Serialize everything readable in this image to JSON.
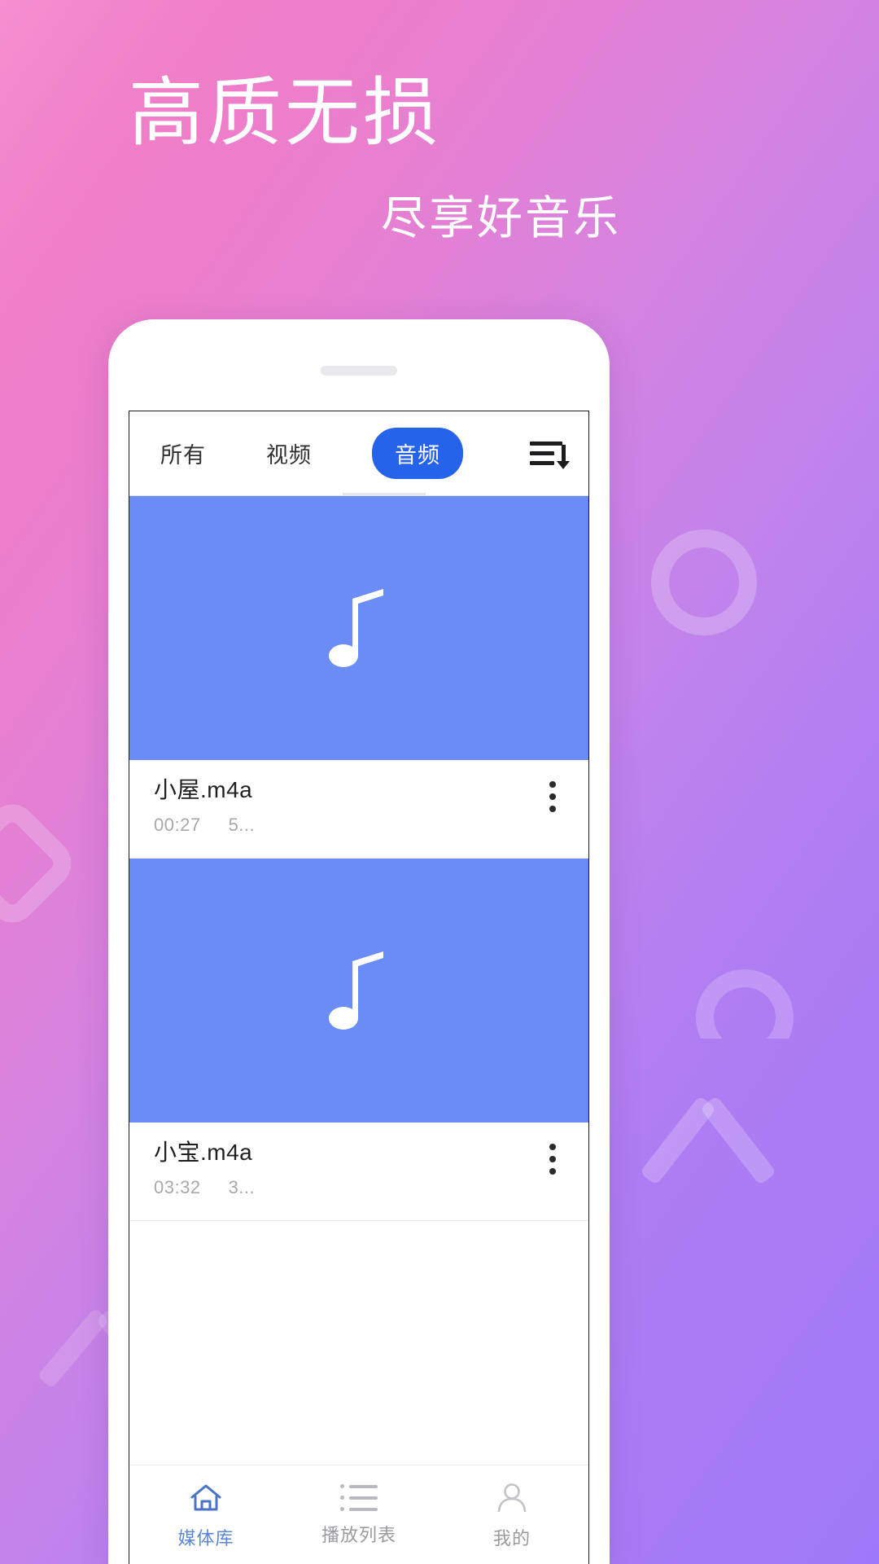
{
  "hero": {
    "title": "高质无损",
    "subtitle": "尽享好音乐"
  },
  "theme": {
    "gradient_start": "#f58fd0",
    "gradient_end": "#9e79f7",
    "accent_blue": "#2563eb",
    "thumb_blue": "#6b8cf5",
    "nav_active": "#5b87d8"
  },
  "app": {
    "tabs": [
      {
        "label": "所有",
        "active": false
      },
      {
        "label": "视频",
        "active": false
      },
      {
        "label": "音频",
        "active": true
      }
    ],
    "sort_icon": "sort-descending-icon",
    "media_items": [
      {
        "thumbnail_icon": "music-note-icon",
        "title": "小屋.m4a",
        "duration": "00:27",
        "size": "5...",
        "menu_icon": "kebab-menu-icon"
      },
      {
        "thumbnail_icon": "music-note-icon",
        "title": "小宝.m4a",
        "duration": "03:32",
        "size": "3...",
        "menu_icon": "kebab-menu-icon"
      }
    ],
    "bottom_nav": [
      {
        "label": "媒体库",
        "icon": "home-icon",
        "active": true
      },
      {
        "label": "播放列表",
        "icon": "playlist-icon",
        "active": false
      },
      {
        "label": "我的",
        "icon": "person-icon",
        "active": false
      }
    ]
  }
}
